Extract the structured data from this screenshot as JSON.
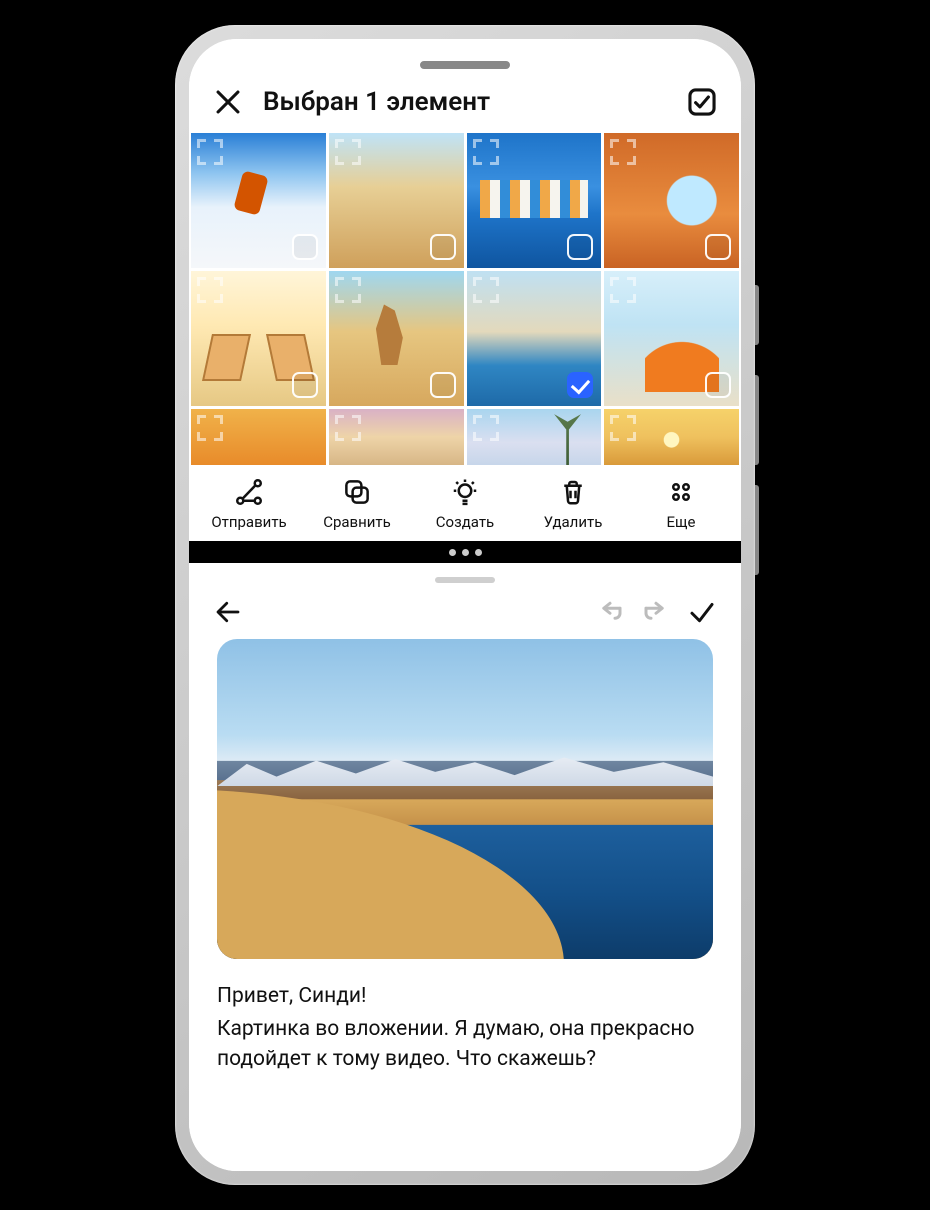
{
  "gallery": {
    "header_title": "Выбран 1 элемент",
    "thumbs": [
      {
        "selected": false,
        "motif": "sky-snow"
      },
      {
        "selected": false,
        "motif": "desert-cam"
      },
      {
        "selected": false,
        "motif": "harbor"
      },
      {
        "selected": false,
        "motif": "arch"
      },
      {
        "selected": false,
        "motif": "beach-chairs"
      },
      {
        "selected": false,
        "motif": "rock-desert"
      },
      {
        "selected": true,
        "motif": "shoreline"
      },
      {
        "selected": false,
        "motif": "umbrella"
      },
      {
        "selected": false,
        "motif": "tent",
        "short": true
      },
      {
        "selected": false,
        "motif": "clouds",
        "short": true
      },
      {
        "selected": false,
        "motif": "palms",
        "short": true
      },
      {
        "selected": false,
        "motif": "sunset",
        "short": true
      }
    ],
    "actions": {
      "send": "Отправить",
      "compare": "Сравнить",
      "create": "Создать",
      "delete": "Удалить",
      "more": "Еще"
    }
  },
  "editor": {
    "note_line1": "Привет, Синди!",
    "note_line2": "Картинка во вложении. Я думаю, она прекрасно подойдет к тому видео. Что скажешь?"
  }
}
